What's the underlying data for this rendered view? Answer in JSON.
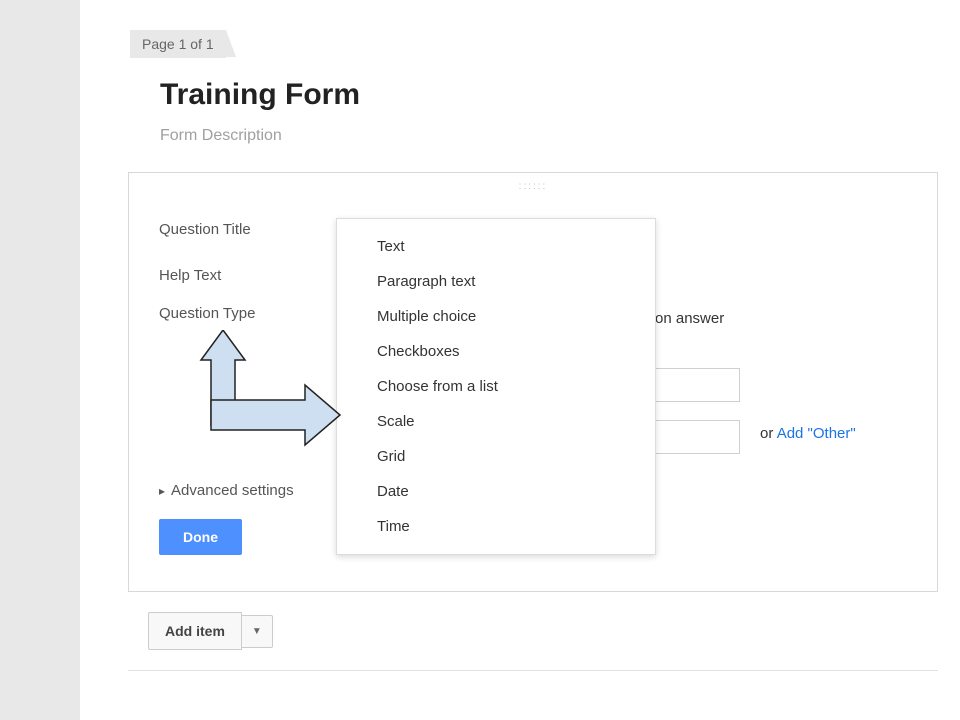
{
  "page_tab": "Page 1 of 1",
  "form": {
    "title": "Training Form",
    "description": "Form Description"
  },
  "labels": {
    "question_title": "Question Title",
    "help_text": "Help Text",
    "question_type": "Question Type",
    "advanced_settings": "Advanced settings"
  },
  "buttons": {
    "done": "Done",
    "add_item": "Add item"
  },
  "dropdown": {
    "items": [
      "Text",
      "Paragraph text",
      "Multiple choice",
      "Checkboxes",
      "Choose from a list",
      "Scale",
      "Grid",
      "Date",
      "Time"
    ]
  },
  "answer_hint_suffix": "on answer",
  "add_other": {
    "prefix": "or ",
    "link": "Add \"Other\""
  },
  "drag_dots": "::::::"
}
